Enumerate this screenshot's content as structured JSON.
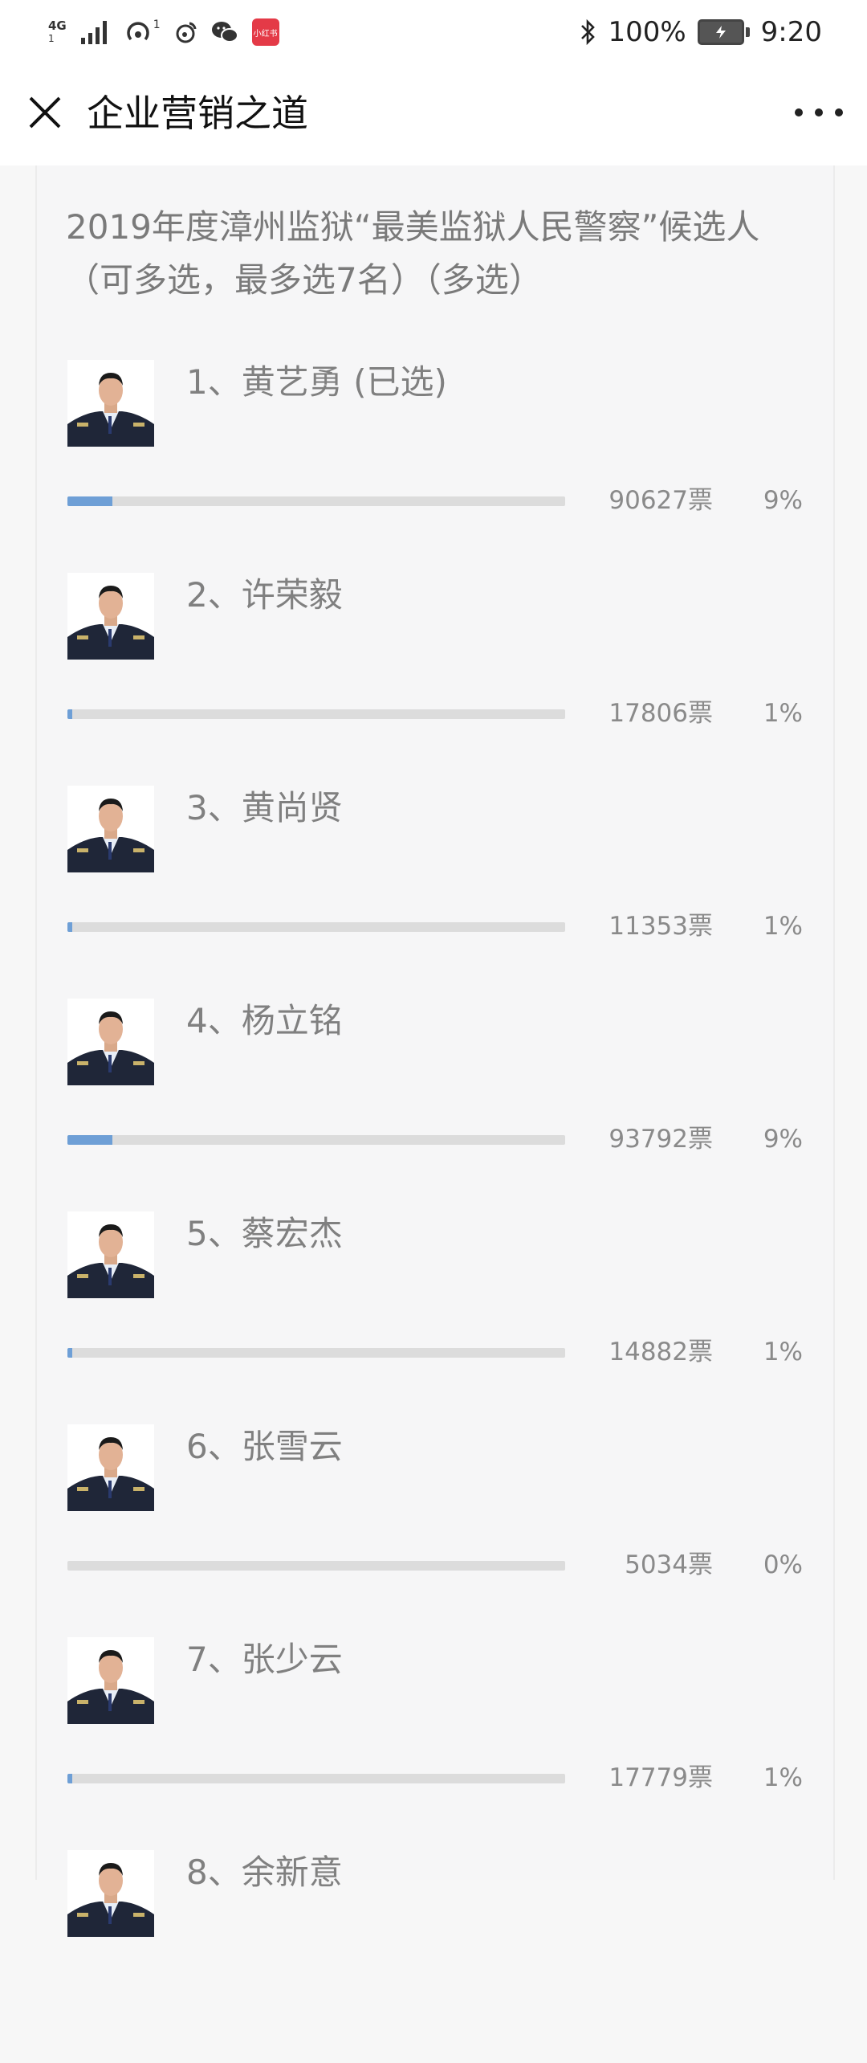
{
  "status_bar": {
    "network": "4G",
    "signal_sub": "1",
    "hotspot_count": "1",
    "app_badge": "小红书",
    "battery": "100%",
    "time": "9:20"
  },
  "nav": {
    "title": "企业营销之道"
  },
  "poll": {
    "question": "2019年度漳州监狱“最美监狱人民警察”候选人（可多选，最多选7名）（多选）",
    "candidates": [
      {
        "label": "1、黄艺勇 (已选)",
        "votes": "90627票",
        "percent": "9%",
        "share": 0.09
      },
      {
        "label": "2、许荣毅",
        "votes": "17806票",
        "percent": "1%",
        "share": 0.01
      },
      {
        "label": "3、黄尚贤",
        "votes": "11353票",
        "percent": "1%",
        "share": 0.01
      },
      {
        "label": "4、杨立铭",
        "votes": "93792票",
        "percent": "9%",
        "share": 0.09
      },
      {
        "label": "5、蔡宏杰",
        "votes": "14882票",
        "percent": "1%",
        "share": 0.01
      },
      {
        "label": "6、张雪云",
        "votes": "5034票",
        "percent": "0%",
        "share": 0.0
      },
      {
        "label": "7、张少云",
        "votes": "17779票",
        "percent": "1%",
        "share": 0.01
      },
      {
        "label": "8、余新意",
        "votes": "",
        "percent": "",
        "share": null
      }
    ]
  },
  "colors": {
    "bar_fill": "#6e9fd6",
    "bar_track": "#dcdcdc"
  }
}
